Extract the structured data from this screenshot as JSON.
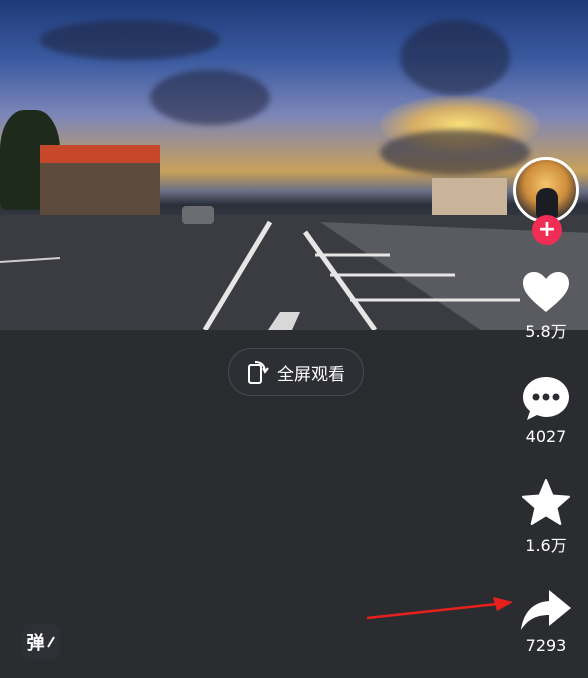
{
  "video": {
    "scene": "street-sunset"
  },
  "fullscreen": {
    "label": "全屏观看",
    "icon": "rotate-screen-icon"
  },
  "creator": {
    "follow_symbol": "+"
  },
  "actions": {
    "like": {
      "icon": "heart-icon",
      "count": "5.8万"
    },
    "comment": {
      "icon": "comment-bubble-icon",
      "count": "4027"
    },
    "favorite": {
      "icon": "star-icon",
      "count": "1.6万"
    },
    "share": {
      "icon": "share-arrow-icon",
      "count": "7293"
    }
  },
  "danmu": {
    "label": "弹"
  },
  "colors": {
    "background": "#2b2c30",
    "accent": "#f02d55",
    "annotation_arrow": "#e8201c"
  }
}
